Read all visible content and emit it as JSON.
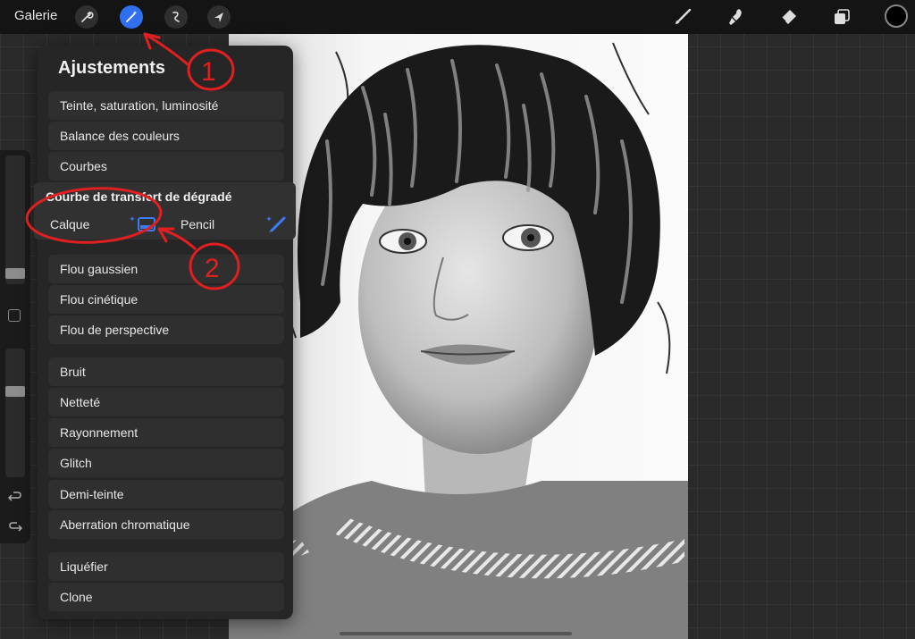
{
  "topbar": {
    "gallery_label": "Galerie",
    "left_tools": [
      "wrench-icon",
      "magic-wand-icon",
      "selection-icon",
      "transform-arrow-icon"
    ],
    "right_tools": [
      "brush-icon",
      "smudge-icon",
      "eraser-icon",
      "layers-icon"
    ],
    "active_color": "#000000"
  },
  "panel": {
    "title": "Ajustements",
    "groups": [
      [
        "Teinte, saturation, luminosité",
        "Balance des couleurs",
        "Courbes"
      ],
      [
        "Flou gaussien",
        "Flou cinétique",
        "Flou de perspective"
      ],
      [
        "Bruit",
        "Netteté",
        "Rayonnement",
        "Glitch",
        "Demi-teinte",
        "Aberration chromatique"
      ],
      [
        "Liquéfier",
        "Clone"
      ]
    ]
  },
  "gradient_map": {
    "title": "Courbe de transfert de dégradé",
    "option_layer": "Calque",
    "option_pencil": "Pencil"
  },
  "annotations": {
    "label_1": "1",
    "label_2": "2",
    "color": "#e02020"
  },
  "colors": {
    "accent": "#2f6ff0",
    "panel_bg": "#262626"
  }
}
